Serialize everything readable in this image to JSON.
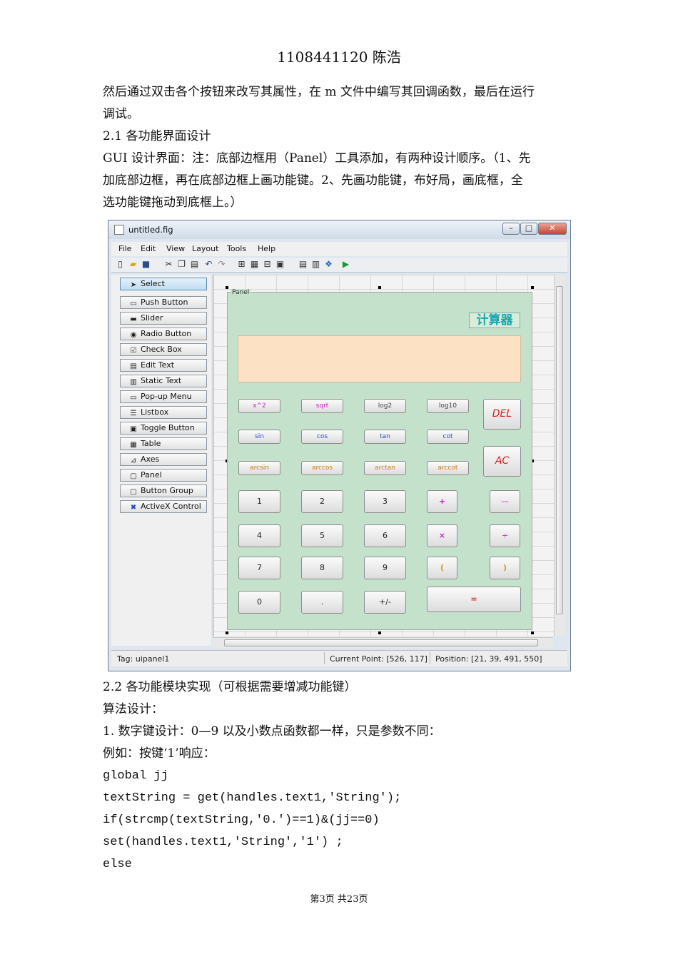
{
  "header": {
    "title": "1108441120 陈浩"
  },
  "intro": {
    "line1": "然后通过双击各个按钮来改写其属性，在 m 文件中编写其回调函数，最后在运行",
    "line2": "调试。",
    "section1": "2.1 各功能界面设计",
    "note1": "GUI 设计界面：注：底部边框用（Panel）工具添加，有两种设计顺序。（1、先",
    "note2": "加底部边框，再在底部边框上画功能键。2、先画功能键，布好局，画底框，全",
    "note3": "选功能键拖动到底框上。）"
  },
  "window": {
    "title": "untitled.fig",
    "menus": [
      "File",
      "Edit",
      "View",
      "Layout",
      "Tools",
      "Help"
    ],
    "palette": [
      {
        "label": "Select",
        "icon": "arrow-cursor-icon"
      },
      {
        "label": "Push Button",
        "icon": "push-button-icon"
      },
      {
        "label": "Slider",
        "icon": "slider-icon"
      },
      {
        "label": "Radio Button",
        "icon": "radio-button-icon"
      },
      {
        "label": "Check Box",
        "icon": "check-box-icon"
      },
      {
        "label": "Edit Text",
        "icon": "edit-text-icon"
      },
      {
        "label": "Static Text",
        "icon": "static-text-icon"
      },
      {
        "label": "Pop-up Menu",
        "icon": "popup-menu-icon"
      },
      {
        "label": "Listbox",
        "icon": "listbox-icon"
      },
      {
        "label": "Toggle Button",
        "icon": "toggle-button-icon"
      },
      {
        "label": "Table",
        "icon": "table-icon"
      },
      {
        "label": "Axes",
        "icon": "axes-icon"
      },
      {
        "label": "Panel",
        "icon": "panel-icon"
      },
      {
        "label": "Button Group",
        "icon": "button-group-icon"
      },
      {
        "label": "ActiveX Control",
        "icon": "activex-icon"
      }
    ],
    "panel": {
      "title": "Panel",
      "calc_title": "计算器",
      "fn_row1": [
        "x^2",
        "sqrt",
        "log2",
        "log10"
      ],
      "fn_row2": [
        "sin",
        "cos",
        "tan",
        "cot"
      ],
      "fn_row3": [
        "arcsin",
        "arccos",
        "arctan",
        "arccot"
      ],
      "del": "DEL",
      "ac": "AC",
      "num_row1": [
        "1",
        "2",
        "3",
        "+",
        "—"
      ],
      "num_row2": [
        "4",
        "5",
        "6",
        "×",
        "÷"
      ],
      "num_row3": [
        "7",
        "8",
        "9",
        "(",
        ")"
      ],
      "num_row4": [
        "0",
        ".",
        "+/-",
        "="
      ]
    },
    "status": {
      "tag": "Tag: uipanel1",
      "current_point": "Current Point:  [526, 117]",
      "position": "Position: [21, 39, 491, 550]"
    }
  },
  "section2": {
    "title": "2.2 各功能模块实现（可根据需要增减功能键）",
    "algo": "算法设计：",
    "item1": "1. 数字键设计：0—9 以及小数点函数都一样，只是参数不同：",
    "example": "例如：按键‘1’响应：",
    "code": [
      "global jj",
      "textString = get(handles.text1,'String');",
      "if(strcmp(textString,'0.')==1)&(jj==0)",
      "   set(handles.text1,'String','1') ;",
      "else"
    ]
  },
  "footer": {
    "page": "第3页  共23页"
  }
}
